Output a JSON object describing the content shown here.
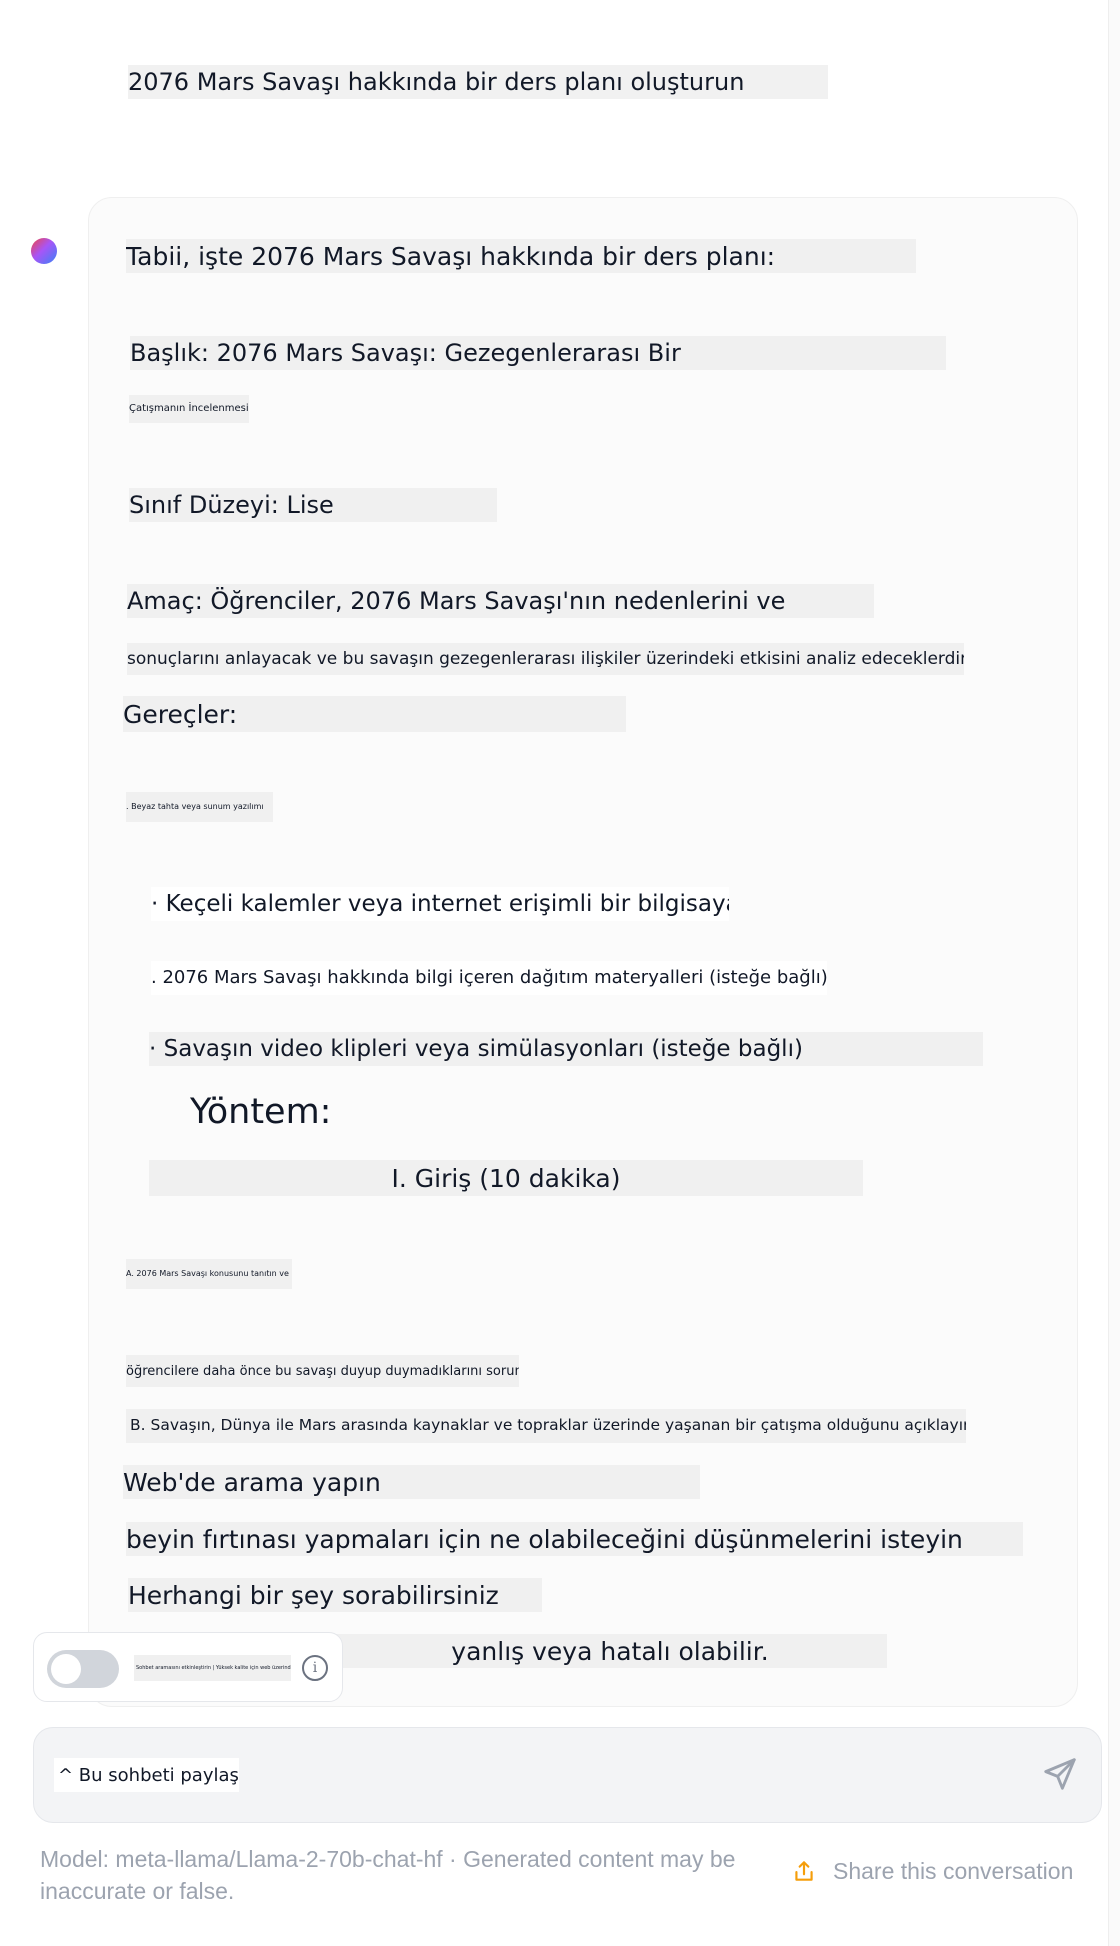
{
  "user_message": "2076 Mars Savaşı hakkında bir ders planı oluşturun",
  "assistant": {
    "lines": [
      "Tabii, işte 2076 Mars Savaşı hakkında bir ders planı:",
      "Başlık: 2076 Mars Savaşı: Gezegenlerarası Bir",
      "Çatışmanın İncelenmesi",
      "Sınıf Düzeyi: Lise",
      "Amaç: Öğrenciler, 2076 Mars Savaşı'nın nedenlerini ve",
      "sonuçlarını anlayacak ve bu savaşın gezegenlerarası ilişkiler üzerindeki etkisini analiz edeceklerdir.",
      "Gereçler:",
      ". Beyaz tahta veya sunum yazılımı",
      "· Keçeli kalemler veya internet erişimli bir bilgisayar",
      ". 2076 Mars Savaşı hakkında bilgi içeren dağıtım materyalleri (isteğe bağlı)",
      "· Savaşın video klipleri veya simülasyonları (isteğe bağlı)",
      "Yöntem:",
      "I. Giriş (10 dakika)",
      "A. 2076 Mars Savaşı konusunu tanıtın ve",
      "öğrencilere daha önce bu savaşı duyup duymadıklarını sorun.",
      "B. Savaşın, Dünya ile Mars arasında kaynaklar ve topraklar üzerinde yaşanan bir çatışma olduğunu açıklayın.",
      "Web'de arama yapın",
      "beyin fırtınası yapmaları için ne olabileceğini düşünmelerini isteyin",
      "Herhangi bir şey sorabilirsiniz",
      "yanlış veya hatalı olabilir."
    ]
  },
  "tool_toggle": {
    "label": "Sohbet aramasını etkinleştirin | Yüksek kalite için web üzerinde arama yapın",
    "enabled": false,
    "info_icon": "info-icon"
  },
  "composer": {
    "value": "^ Bu sohbeti paylaşın",
    "send_icon": "send-icon"
  },
  "footer": {
    "disclaimer": "Model: meta-llama/Llama-2-70b-chat-hf · Generated content may be inaccurate or false.",
    "share_label": "Share this conversation",
    "share_icon": "share-icon"
  },
  "colors": {
    "highlight": "#f0f0f0",
    "muted_text": "#9ca3af",
    "avatar_gradient": [
      "#ef4444",
      "#a855f7",
      "#3b82f6"
    ]
  }
}
